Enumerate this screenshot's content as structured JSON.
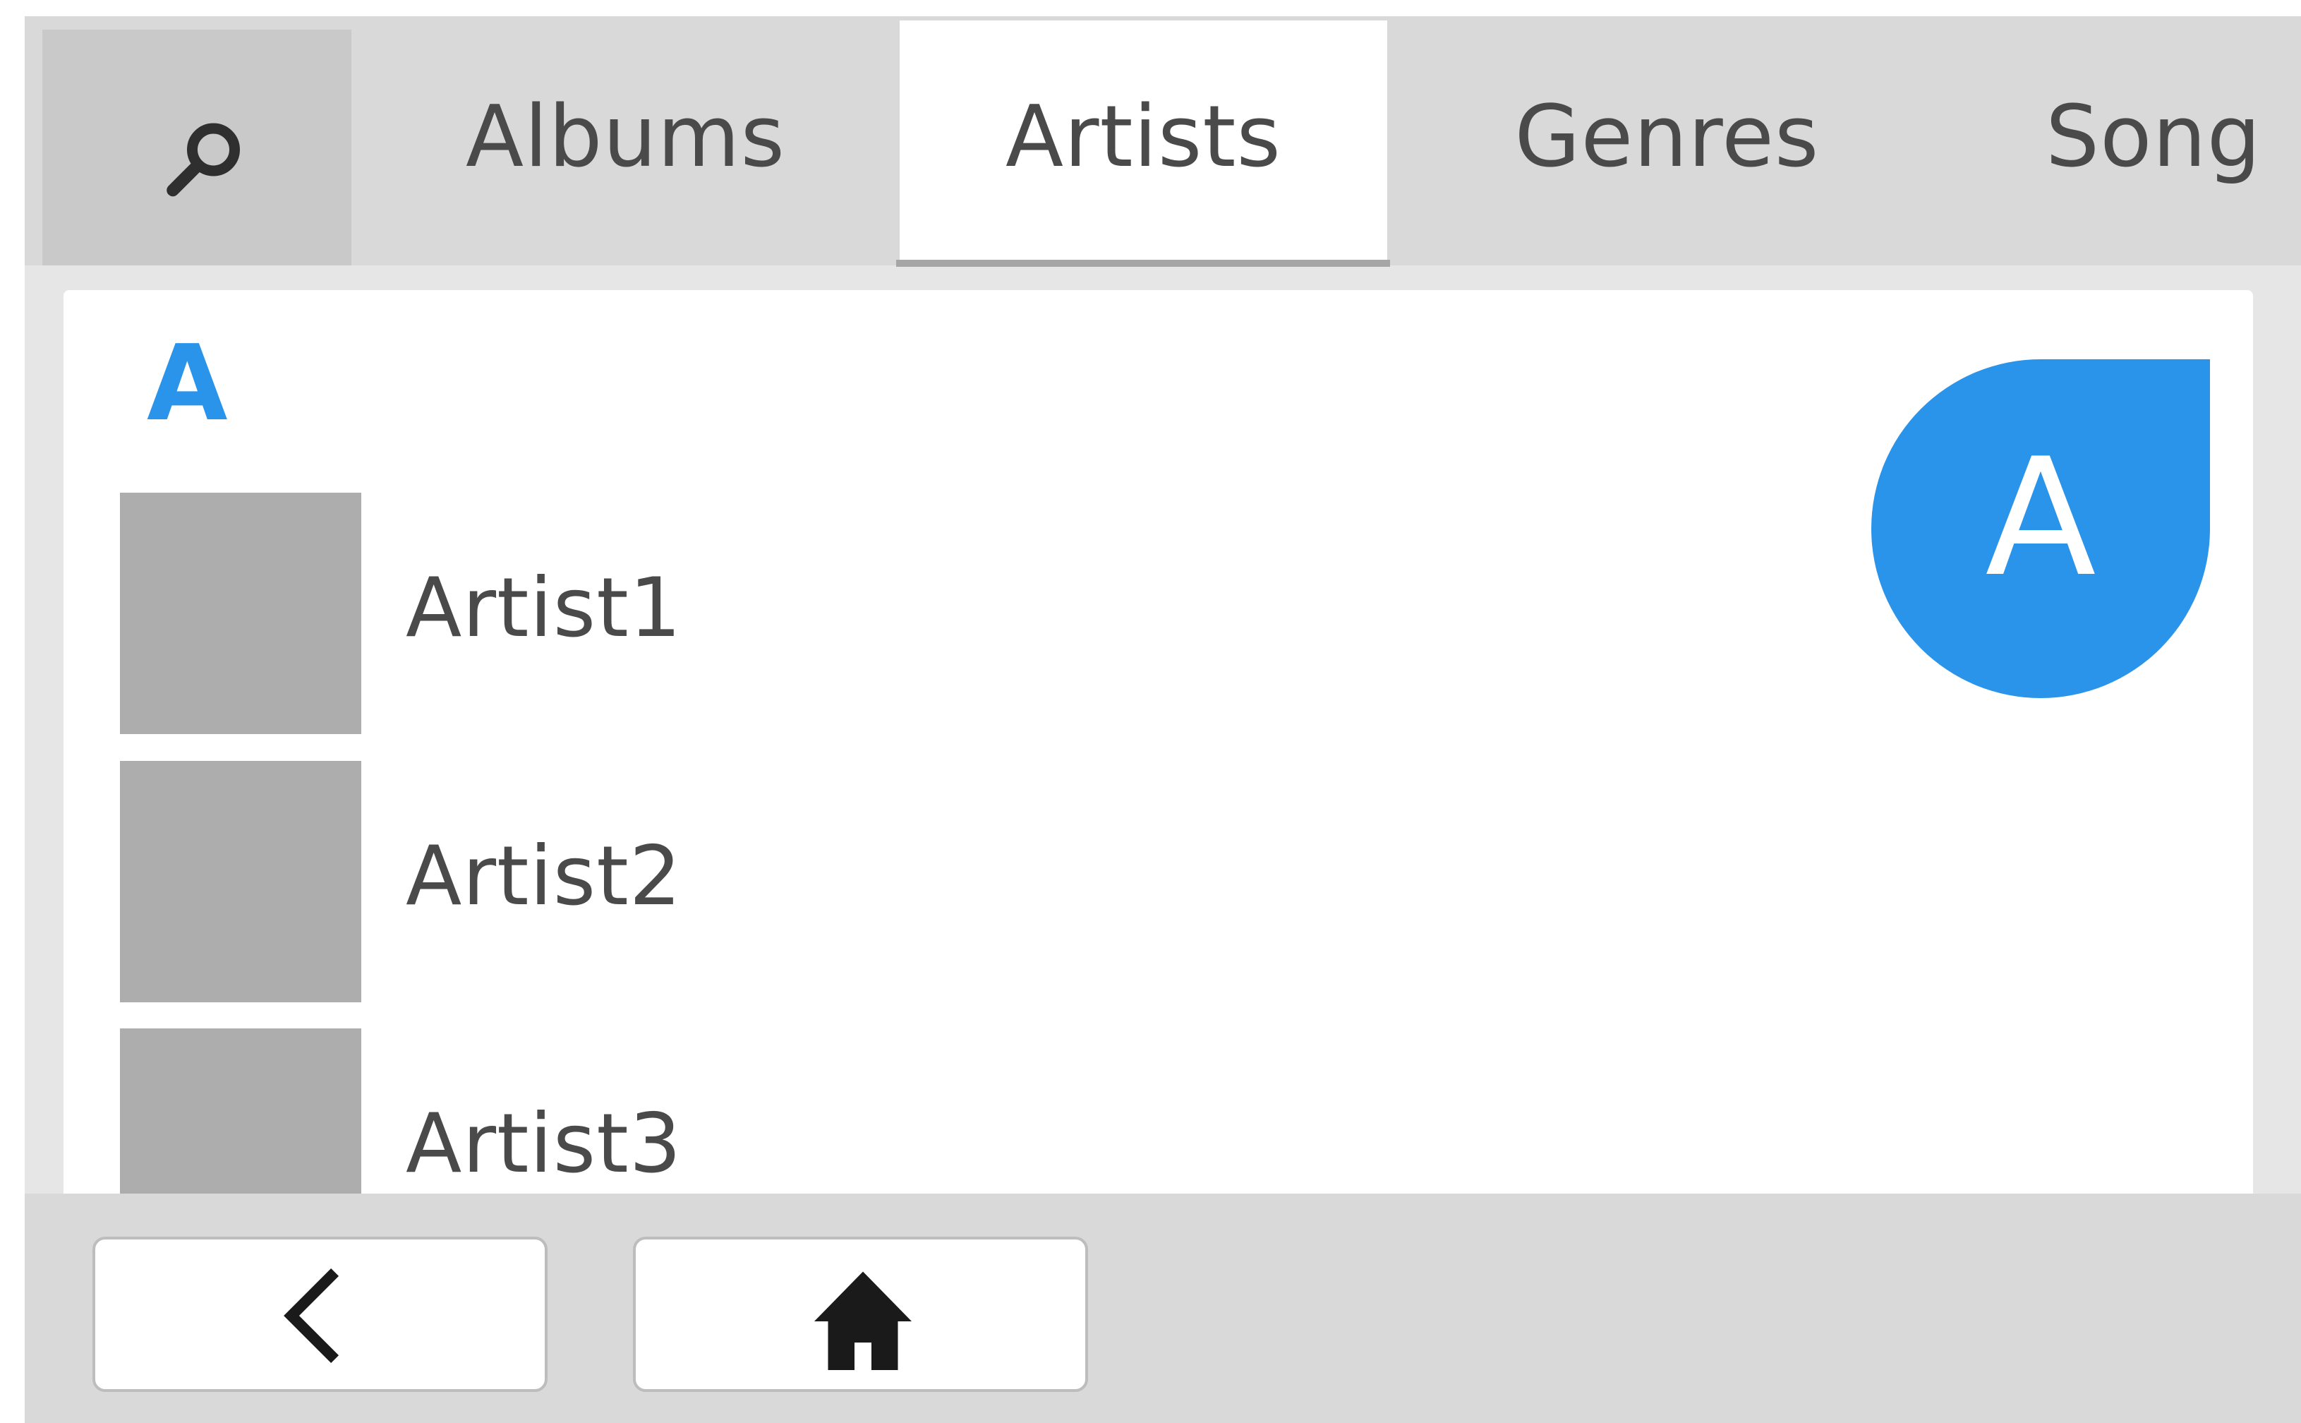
{
  "tabs": {
    "search_icon": "search-icon",
    "items": [
      {
        "label": "Albums",
        "selected": false
      },
      {
        "label": "Artists",
        "selected": true
      },
      {
        "label": "Genres",
        "selected": false
      },
      {
        "label": "Song",
        "selected": false
      }
    ]
  },
  "list": {
    "section_header": "A",
    "items": [
      {
        "label": "Artist1"
      },
      {
        "label": "Artist2"
      },
      {
        "label": "Artist3"
      }
    ]
  },
  "fast_scroll": {
    "letter": "A"
  },
  "bottom_bar": {
    "back_icon": "chevron-left-icon",
    "home_icon": "home-icon"
  },
  "colors": {
    "accent": "#2a93ea",
    "tabbar_bg": "#d9d9d9",
    "thumb_placeholder": "#adadad",
    "text": "#4a4a4a"
  }
}
